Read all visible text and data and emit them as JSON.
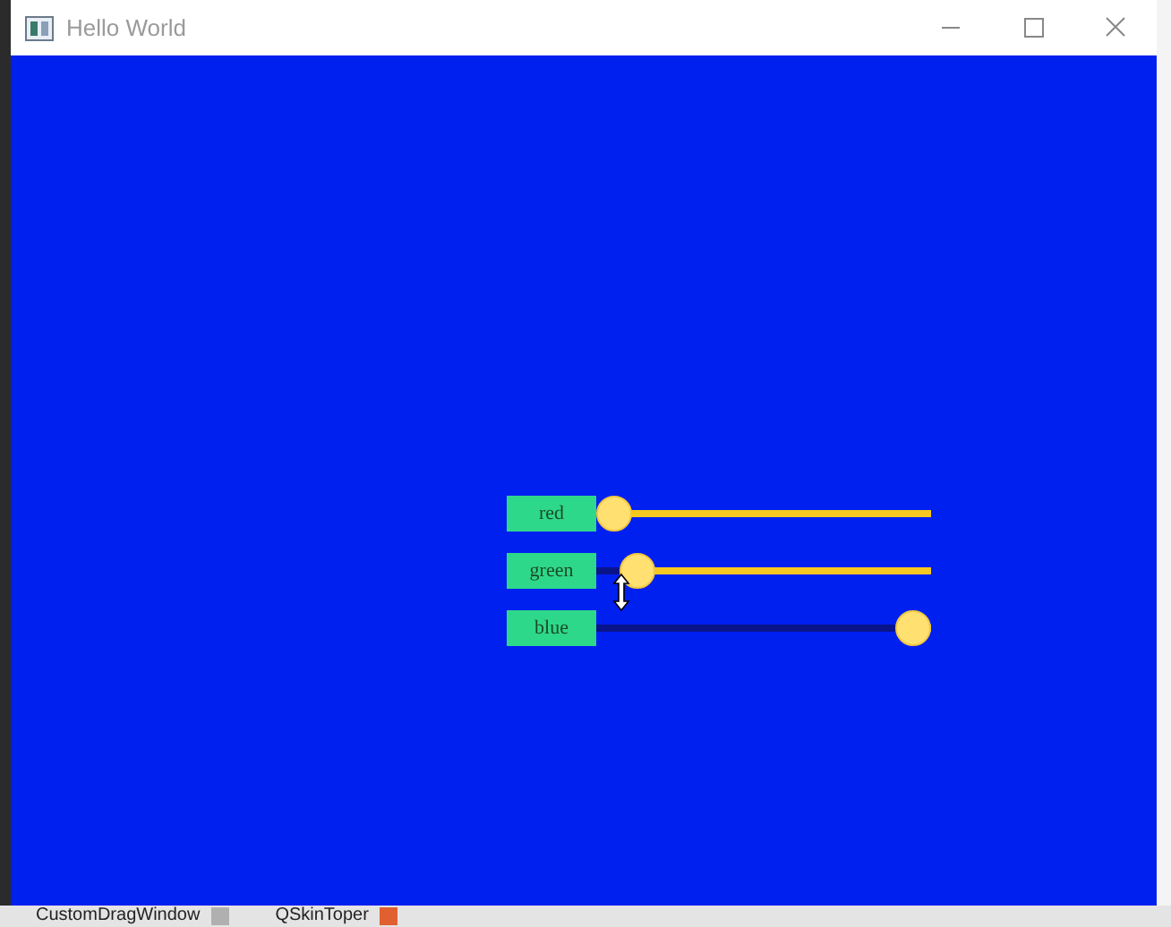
{
  "window": {
    "title": "Hello World"
  },
  "sliders": [
    {
      "label": "red",
      "level": 0
    },
    {
      "label": "green",
      "level": 0.08
    },
    {
      "label": "blue",
      "level": 1
    }
  ],
  "taskbar": {
    "items": [
      "CustomDragWindow",
      "QSkinToper"
    ]
  }
}
